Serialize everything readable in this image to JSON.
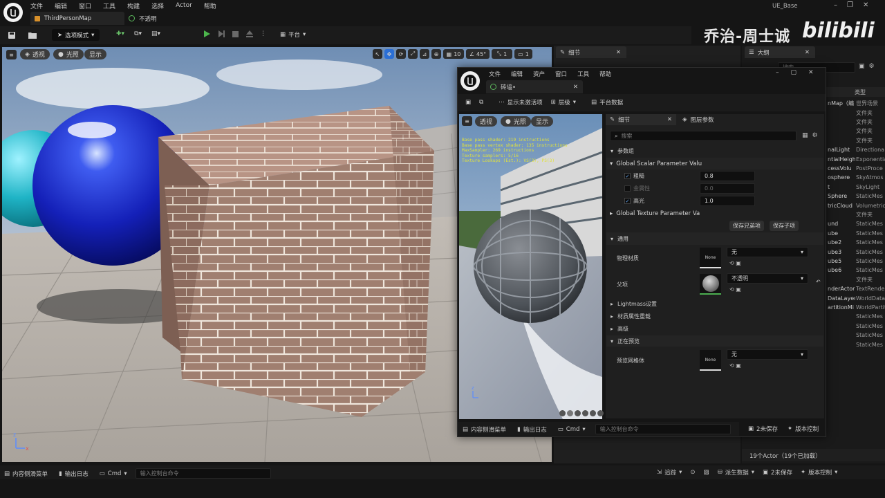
{
  "app": {
    "project_name": "UE_Base",
    "menu": [
      "文件",
      "编辑",
      "窗口",
      "工具",
      "构建",
      "选择",
      "Actor",
      "帮助"
    ],
    "tabs": [
      {
        "label": "ThirdPersonMap"
      },
      {
        "label": "不透明"
      }
    ],
    "toolbar": {
      "mode_label": "选项模式",
      "platform_label": "平台"
    }
  },
  "watermark": {
    "text": "乔治-周士诚",
    "logo": "bilibili"
  },
  "viewport": {
    "btn_perspective": "透视",
    "btn_lit": "光照",
    "btn_show": "显示",
    "grid_value": "10",
    "angle_value": "45°",
    "scale_value": "1",
    "camera_value": "1"
  },
  "details_tab": {
    "label": "细节"
  },
  "outliner": {
    "tab_label": "大纲",
    "search_placeholder": "搜索...",
    "col_type": "类型",
    "rows": [
      {
        "name": "nMap（编",
        "type": "世界场景"
      },
      {
        "name": "",
        "type": "文件夹"
      },
      {
        "name": "",
        "type": "文件夹"
      },
      {
        "name": "",
        "type": "文件夹"
      },
      {
        "name": "",
        "type": "文件夹"
      },
      {
        "name": "nalLight",
        "type": "Directiona"
      },
      {
        "name": "ntialHeigh",
        "type": "Exponentia"
      },
      {
        "name": "cessVolu",
        "type": "PostProce"
      },
      {
        "name": "osphere",
        "type": "SkyAtmos"
      },
      {
        "name": "t",
        "type": "SkyLight"
      },
      {
        "name": "Sphere",
        "type": "StaticMes"
      },
      {
        "name": "tricCloud",
        "type": "Volumetric"
      },
      {
        "name": "",
        "type": "文件夹"
      },
      {
        "name": "und",
        "type": "StaticMes"
      },
      {
        "name": "ube",
        "type": "StaticMes"
      },
      {
        "name": "ube2",
        "type": "StaticMes"
      },
      {
        "name": "ube3",
        "type": "StaticMes"
      },
      {
        "name": "ube5",
        "type": "StaticMes"
      },
      {
        "name": "ube6",
        "type": "StaticMes"
      },
      {
        "name": "",
        "type": "文件夹"
      },
      {
        "name": "nderActor",
        "type": "TextRende"
      },
      {
        "name": "DataLayers",
        "type": "WorldData"
      },
      {
        "name": "artitionMi",
        "type": "WorldPartit"
      },
      {
        "name": "",
        "type": "StaticMes"
      },
      {
        "name": "",
        "type": "StaticMes"
      },
      {
        "name": "",
        "type": "StaticMes"
      },
      {
        "name": "",
        "type": "StaticMes"
      }
    ],
    "footer_saves": "2未保存",
    "footer_vcs": "版本控制",
    "actor_count": "19个Actor（19个已加载）"
  },
  "material_window": {
    "menu": [
      "文件",
      "编辑",
      "资产",
      "窗口",
      "工具",
      "帮助"
    ],
    "tab_label": "砖墙•",
    "toolbar": {
      "show_inactive": "显示未激活项",
      "hierarchy": "层级",
      "platform_data": "平台数据"
    },
    "preview": {
      "btn_perspective": "透视",
      "btn_lit": "光照",
      "btn_show": "显示",
      "stats": [
        "Base pass shader: 219 instructions",
        "Base pass vertex shader: 135 instructions",
        "MaxSampler: 269 instructions",
        "Texture samplers: 5/16",
        "Texture Lookups (Est.): VS(3), PS(3)"
      ]
    },
    "details": {
      "tab_details": "细节",
      "tab_layer_params": "图层参数",
      "search_placeholder": "搜索",
      "section_params": "参数组",
      "group_scalar": "Global Scalar Parameter Valu",
      "scalar_params": [
        {
          "name": "粗糙",
          "checked": true,
          "value": "0.8"
        },
        {
          "name": "金属性",
          "checked": false,
          "value": "0.0"
        },
        {
          "name": "高光",
          "checked": true,
          "value": "1.0"
        }
      ],
      "group_texture": "Global Texture Parameter Va",
      "btn_save_sibling": "保存兄弟项",
      "btn_save_child": "保存子项",
      "section_general": "通用",
      "phys_material_label": "物理材质",
      "phys_material_thumb": "None",
      "phys_material_value": "无",
      "parent_label": "父项",
      "parent_value": "不透明",
      "section_lightmass": "Lightmass设置",
      "section_mat_override": "材质属性重载",
      "section_advanced": "高级",
      "section_previewing": "正在预览",
      "preview_mesh_label": "预览网格体",
      "preview_mesh_thumb": "None",
      "preview_mesh_value": "无"
    },
    "statusbar": {
      "content_drawer": "内容侧滑菜单",
      "output_log": "输出日志",
      "cmd": "Cmd",
      "console_placeholder": "输入控制台命令"
    }
  },
  "statusbar": {
    "content_drawer": "内容侧滑菜单",
    "output_log": "输出日志",
    "cmd": "Cmd",
    "console_placeholder": "输入控制台命令",
    "trace": "追踪",
    "derived_data": "派生数据",
    "unsaved": "2未保存",
    "vcs": "版本控制"
  }
}
